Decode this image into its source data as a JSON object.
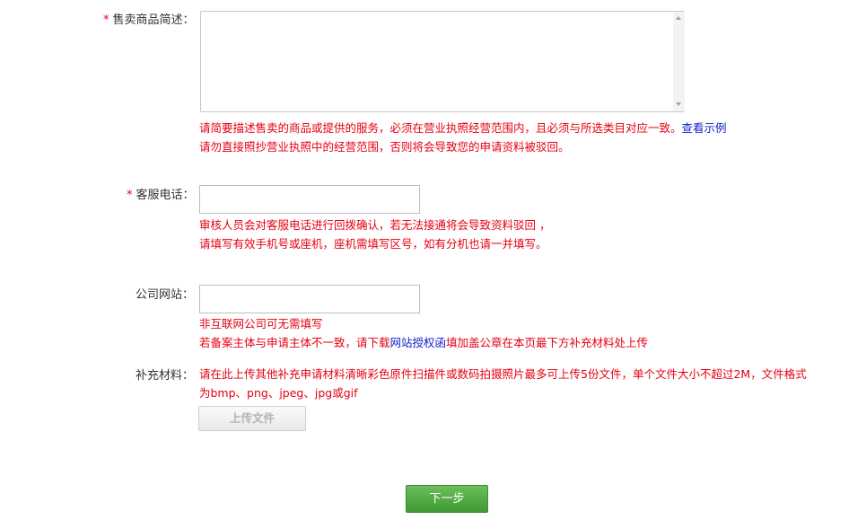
{
  "description": {
    "required_mark": "*",
    "label": "售卖商品简述：",
    "value": "",
    "hint_line1": "请简要描述售卖的商品或提供的服务，必须在营业执照经营范围内，且必须与所选类目对应一致。",
    "example_link": "查看示例",
    "hint_line2": "请勿直接照抄营业执照中的经营范围，否则将会导致您的申请资料被驳回。"
  },
  "phone": {
    "required_mark": "*",
    "label": "客服电话：",
    "value": "",
    "hint_line1": "审核人员会对客服电话进行回拨确认，若无法接通将会导致资料驳回 ，",
    "hint_line2": "请填写有效手机号或座机，座机需填写区号，如有分机也请一并填写。"
  },
  "website": {
    "label": "公司网站：",
    "value": "",
    "hint_line1": "非互联网公司可无需填写",
    "hint_line2_prefix": "若备案主体与申请主体不一致，请下载",
    "hint_link": "网站授权函",
    "hint_line2_suffix": "填加盖公章在本页最下方补充材料处上传"
  },
  "supplement": {
    "label": "补充材料：",
    "hint_line1": "请在此上传其他补充申请材料清晰彩色原件扫描件或数码拍摄照片最多可上传5份文件，单个文件大小不超过2M，文件格式",
    "hint_line2": "为bmp、png、jpeg、jpg或gif",
    "upload_label": "上传文件"
  },
  "next_button": "下一步",
  "colors": {
    "hint_red": "#e60012",
    "link_blue": "#1020c8",
    "next_green": "#4caa3c"
  }
}
